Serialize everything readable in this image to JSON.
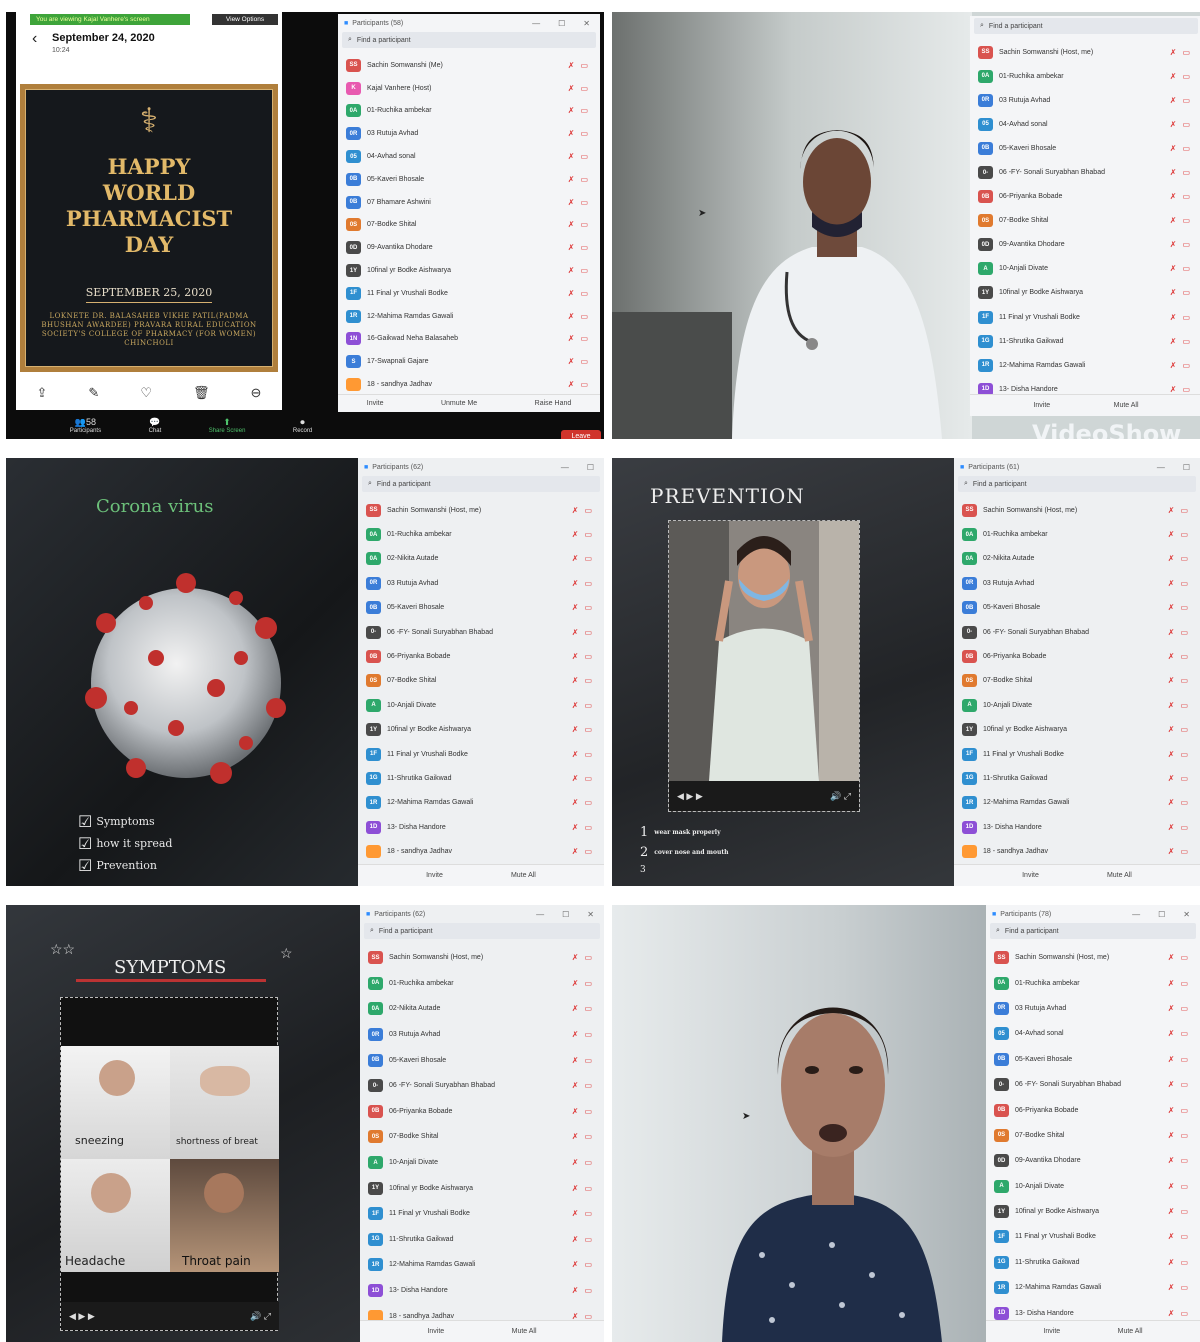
{
  "tile1": {
    "share_banner": "You are viewing Kajal Vanhere's screen",
    "view_options": "View Options",
    "phone_date": "September 24, 2020",
    "phone_time": "10:24",
    "poster": {
      "line1": "HAPPY",
      "line2": "WORLD",
      "line3": "PHARMACIST",
      "line4": "DAY",
      "date": "SEPTEMBER 25, 2020",
      "org": "LOKNETE DR. BALASAHEB VIKHE PATIL(PADMA BHUSHAN AWARDEE) PRAVARA RURAL EDUCATION SOCIETY'S COLLEGE OF PHARMACY (FOR WOMEN) CHINCHOLI"
    },
    "toolbar": {
      "participants_count": "58",
      "participants": "Participants",
      "chat": "Chat",
      "share_screen": "Share Screen",
      "record": "Record",
      "leave": "Leave"
    },
    "panel": {
      "title": "Participants (58)",
      "search": "Find a participant",
      "rows": [
        {
          "av": "SS",
          "color": "#d9534f",
          "name": "Sachin Somwanshi (Me)"
        },
        {
          "av": "K",
          "color": "#e85ab0",
          "name": "Kajal Vanhere (Host)"
        },
        {
          "av": "0A",
          "color": "#2ea86b",
          "name": "01-Ruchika ambekar"
        },
        {
          "av": "0R",
          "color": "#3b7dd8",
          "name": "03 Rutuja Avhad"
        },
        {
          "av": "05",
          "color": "#2f8fd0",
          "name": "04-Avhad sonal"
        },
        {
          "av": "0B",
          "color": "#3b7dd8",
          "name": "05-Kaveri Bhosale"
        },
        {
          "av": "0B",
          "color": "#3b7dd8",
          "name": "07 Bhamare Ashwini"
        },
        {
          "av": "0S",
          "color": "#e07a2f",
          "name": "07-Bodke Shital"
        },
        {
          "av": "0D",
          "color": "#4a4a4a",
          "name": "09-Avantika Dhodare"
        },
        {
          "av": "1Y",
          "color": "#4a4a4a",
          "name": "10final yr Bodke Aishwarya"
        },
        {
          "av": "1F",
          "color": "#2f8fd0",
          "name": "11 Final yr Vrushali Bodke"
        },
        {
          "av": "1R",
          "color": "#2f8fd0",
          "name": "12-Mahima Ramdas Gawali"
        },
        {
          "av": "1N",
          "color": "#8d4fd6",
          "name": "16-Gaikwad Neha Balasaheb"
        },
        {
          "av": "S",
          "color": "#3b7dd8",
          "name": "17-Swapnali Gajare"
        },
        {
          "av": "",
          "color": "#ff9933",
          "name": "18 - sandhya Jadhav"
        }
      ],
      "footer": [
        "Invite",
        "Unmute Me",
        "Raise Hand"
      ]
    }
  },
  "tile2": {
    "panel": {
      "search": "Find a participant",
      "rows": [
        {
          "av": "SS",
          "color": "#d9534f",
          "name": "Sachin Somwanshi (Host, me)"
        },
        {
          "av": "0A",
          "color": "#2ea86b",
          "name": "01-Ruchika ambekar"
        },
        {
          "av": "0R",
          "color": "#3b7dd8",
          "name": "03 Rutuja Avhad"
        },
        {
          "av": "05",
          "color": "#2f8fd0",
          "name": "04-Avhad sonal"
        },
        {
          "av": "0B",
          "color": "#3b7dd8",
          "name": "05-Kaveri Bhosale"
        },
        {
          "av": "0-",
          "color": "#4a4a4a",
          "name": "06 -FY- Sonali Suryabhan Bhabad"
        },
        {
          "av": "0B",
          "color": "#d9534f",
          "name": "06-Priyanka Bobade"
        },
        {
          "av": "0S",
          "color": "#e07a2f",
          "name": "07-Bodke Shital"
        },
        {
          "av": "0D",
          "color": "#4a4a4a",
          "name": "09-Avantika Dhodare"
        },
        {
          "av": "A",
          "color": "#2ea86b",
          "name": "10-Anjali Divate"
        },
        {
          "av": "1Y",
          "color": "#4a4a4a",
          "name": "10final yr Bodke Aishwarya"
        },
        {
          "av": "1F",
          "color": "#2f8fd0",
          "name": "11 Final yr Vrushali Bodke"
        },
        {
          "av": "1G",
          "color": "#2f8fd0",
          "name": "11-Shrutika Gaikwad"
        },
        {
          "av": "1R",
          "color": "#2f8fd0",
          "name": "12-Mahima Ramdas Gawali"
        },
        {
          "av": "1D",
          "color": "#8d4fd6",
          "name": "13- Disha Handore"
        }
      ],
      "footer": [
        "Invite",
        "Mute All"
      ]
    },
    "watermark": "VideoShow"
  },
  "tile3": {
    "slide_title": "Corona virus",
    "checklist": [
      "Symptoms",
      "how it spread",
      "Prevention"
    ],
    "panel": {
      "title": "Participants (62)",
      "search": "Find a participant",
      "rows": [
        {
          "av": "SS",
          "color": "#d9534f",
          "name": "Sachin Somwanshi (Host, me)"
        },
        {
          "av": "0A",
          "color": "#2ea86b",
          "name": "01-Ruchika ambekar"
        },
        {
          "av": "0A",
          "color": "#2ea86b",
          "name": "02-Nikita Autade"
        },
        {
          "av": "0R",
          "color": "#3b7dd8",
          "name": "03 Rutuja Avhad"
        },
        {
          "av": "0B",
          "color": "#3b7dd8",
          "name": "05-Kaveri Bhosale"
        },
        {
          "av": "0-",
          "color": "#4a4a4a",
          "name": "06 -FY- Sonali Suryabhan Bhabad"
        },
        {
          "av": "0B",
          "color": "#d9534f",
          "name": "06-Priyanka Bobade"
        },
        {
          "av": "0S",
          "color": "#e07a2f",
          "name": "07-Bodke Shital"
        },
        {
          "av": "A",
          "color": "#2ea86b",
          "name": "10-Anjali Divate"
        },
        {
          "av": "1Y",
          "color": "#4a4a4a",
          "name": "10final yr Bodke Aishwarya"
        },
        {
          "av": "1F",
          "color": "#2f8fd0",
          "name": "11 Final yr Vrushali Bodke"
        },
        {
          "av": "1G",
          "color": "#2f8fd0",
          "name": "11-Shrutika Gaikwad"
        },
        {
          "av": "1R",
          "color": "#2f8fd0",
          "name": "12-Mahima Ramdas Gawali"
        },
        {
          "av": "1D",
          "color": "#8d4fd6",
          "name": "13- Disha Handore"
        },
        {
          "av": "",
          "color": "#ff9933",
          "name": "18 - sandhya Jadhav"
        }
      ],
      "footer": [
        "Invite",
        "Mute All"
      ]
    }
  },
  "tile4": {
    "slide_title": "PREVENTION",
    "steps": [
      {
        "n": "1",
        "text": "wear mask properly"
      },
      {
        "n": "2",
        "text": "cover nose and mouth"
      },
      {
        "n": "3",
        "text": ""
      }
    ],
    "panel": {
      "title": "Participants (61)",
      "search": "Find a participant",
      "rows": [
        {
          "av": "SS",
          "color": "#d9534f",
          "name": "Sachin Somwanshi (Host, me)"
        },
        {
          "av": "0A",
          "color": "#2ea86b",
          "name": "01-Ruchika ambekar"
        },
        {
          "av": "0A",
          "color": "#2ea86b",
          "name": "02-Nikita Autade"
        },
        {
          "av": "0R",
          "color": "#3b7dd8",
          "name": "03 Rutuja Avhad"
        },
        {
          "av": "0B",
          "color": "#3b7dd8",
          "name": "05-Kaveri Bhosale"
        },
        {
          "av": "0-",
          "color": "#4a4a4a",
          "name": "06 -FY- Sonali Suryabhan Bhabad"
        },
        {
          "av": "0B",
          "color": "#d9534f",
          "name": "06-Priyanka Bobade"
        },
        {
          "av": "0S",
          "color": "#e07a2f",
          "name": "07-Bodke Shital"
        },
        {
          "av": "A",
          "color": "#2ea86b",
          "name": "10-Anjali Divate"
        },
        {
          "av": "1Y",
          "color": "#4a4a4a",
          "name": "10final yr Bodke Aishwarya"
        },
        {
          "av": "1F",
          "color": "#2f8fd0",
          "name": "11 Final yr Vrushali Bodke"
        },
        {
          "av": "1G",
          "color": "#2f8fd0",
          "name": "11-Shrutika Gaikwad"
        },
        {
          "av": "1R",
          "color": "#2f8fd0",
          "name": "12-Mahima Ramdas Gawali"
        },
        {
          "av": "1D",
          "color": "#8d4fd6",
          "name": "13- Disha Handore"
        },
        {
          "av": "",
          "color": "#ff9933",
          "name": "18 - sandhya Jadhav"
        }
      ],
      "footer": [
        "Invite",
        "Mute All"
      ]
    }
  },
  "tile5": {
    "slide_title": "SYMPTOMS",
    "captions": [
      "sneezing",
      "shortness of breat",
      "Headache",
      "Throat pain"
    ],
    "panel": {
      "title": "Participants (62)",
      "search": "Find a participant",
      "rows": [
        {
          "av": "SS",
          "color": "#d9534f",
          "name": "Sachin Somwanshi (Host, me)"
        },
        {
          "av": "0A",
          "color": "#2ea86b",
          "name": "01-Ruchika ambekar"
        },
        {
          "av": "0A",
          "color": "#2ea86b",
          "name": "02-Nikita Autade"
        },
        {
          "av": "0R",
          "color": "#3b7dd8",
          "name": "03 Rutuja Avhad"
        },
        {
          "av": "0B",
          "color": "#3b7dd8",
          "name": "05-Kaveri Bhosale"
        },
        {
          "av": "0-",
          "color": "#4a4a4a",
          "name": "06 -FY- Sonali Suryabhan Bhabad"
        },
        {
          "av": "0B",
          "color": "#d9534f",
          "name": "06-Priyanka Bobade"
        },
        {
          "av": "0S",
          "color": "#e07a2f",
          "name": "07-Bodke Shital"
        },
        {
          "av": "A",
          "color": "#2ea86b",
          "name": "10-Anjali Divate"
        },
        {
          "av": "1Y",
          "color": "#4a4a4a",
          "name": "10final yr Bodke Aishwarya"
        },
        {
          "av": "1F",
          "color": "#2f8fd0",
          "name": "11 Final yr Vrushali Bodke"
        },
        {
          "av": "1G",
          "color": "#2f8fd0",
          "name": "11-Shrutika Gaikwad"
        },
        {
          "av": "1R",
          "color": "#2f8fd0",
          "name": "12-Mahima Ramdas Gawali"
        },
        {
          "av": "1D",
          "color": "#8d4fd6",
          "name": "13- Disha Handore"
        },
        {
          "av": "",
          "color": "#ff9933",
          "name": "18 - sandhya Jadhav"
        }
      ],
      "footer": [
        "Invite",
        "Mute All"
      ]
    }
  },
  "tile6": {
    "panel": {
      "title": "Participants (78)",
      "search": "Find a participant",
      "rows": [
        {
          "av": "SS",
          "color": "#d9534f",
          "name": "Sachin Somwanshi (Host, me)"
        },
        {
          "av": "0A",
          "color": "#2ea86b",
          "name": "01-Ruchika ambekar"
        },
        {
          "av": "0R",
          "color": "#3b7dd8",
          "name": "03 Rutuja Avhad"
        },
        {
          "av": "05",
          "color": "#2f8fd0",
          "name": "04-Avhad sonal"
        },
        {
          "av": "0B",
          "color": "#3b7dd8",
          "name": "05-Kaveri Bhosale"
        },
        {
          "av": "0-",
          "color": "#4a4a4a",
          "name": "06 -FY- Sonali Suryabhan Bhabad"
        },
        {
          "av": "0B",
          "color": "#d9534f",
          "name": "06-Priyanka Bobade"
        },
        {
          "av": "0S",
          "color": "#e07a2f",
          "name": "07-Bodke Shital"
        },
        {
          "av": "0D",
          "color": "#4a4a4a",
          "name": "09-Avantika Dhodare"
        },
        {
          "av": "A",
          "color": "#2ea86b",
          "name": "10-Anjali Divate"
        },
        {
          "av": "1Y",
          "color": "#4a4a4a",
          "name": "10final yr Bodke Aishwarya"
        },
        {
          "av": "1F",
          "color": "#2f8fd0",
          "name": "11 Final yr Vrushali Bodke"
        },
        {
          "av": "1G",
          "color": "#2f8fd0",
          "name": "11-Shrutika Gaikwad"
        },
        {
          "av": "1R",
          "color": "#2f8fd0",
          "name": "12-Mahima Ramdas Gawali"
        },
        {
          "av": "1D",
          "color": "#8d4fd6",
          "name": "13- Disha Handore"
        }
      ],
      "footer": [
        "Invite",
        "Mute All"
      ]
    }
  }
}
